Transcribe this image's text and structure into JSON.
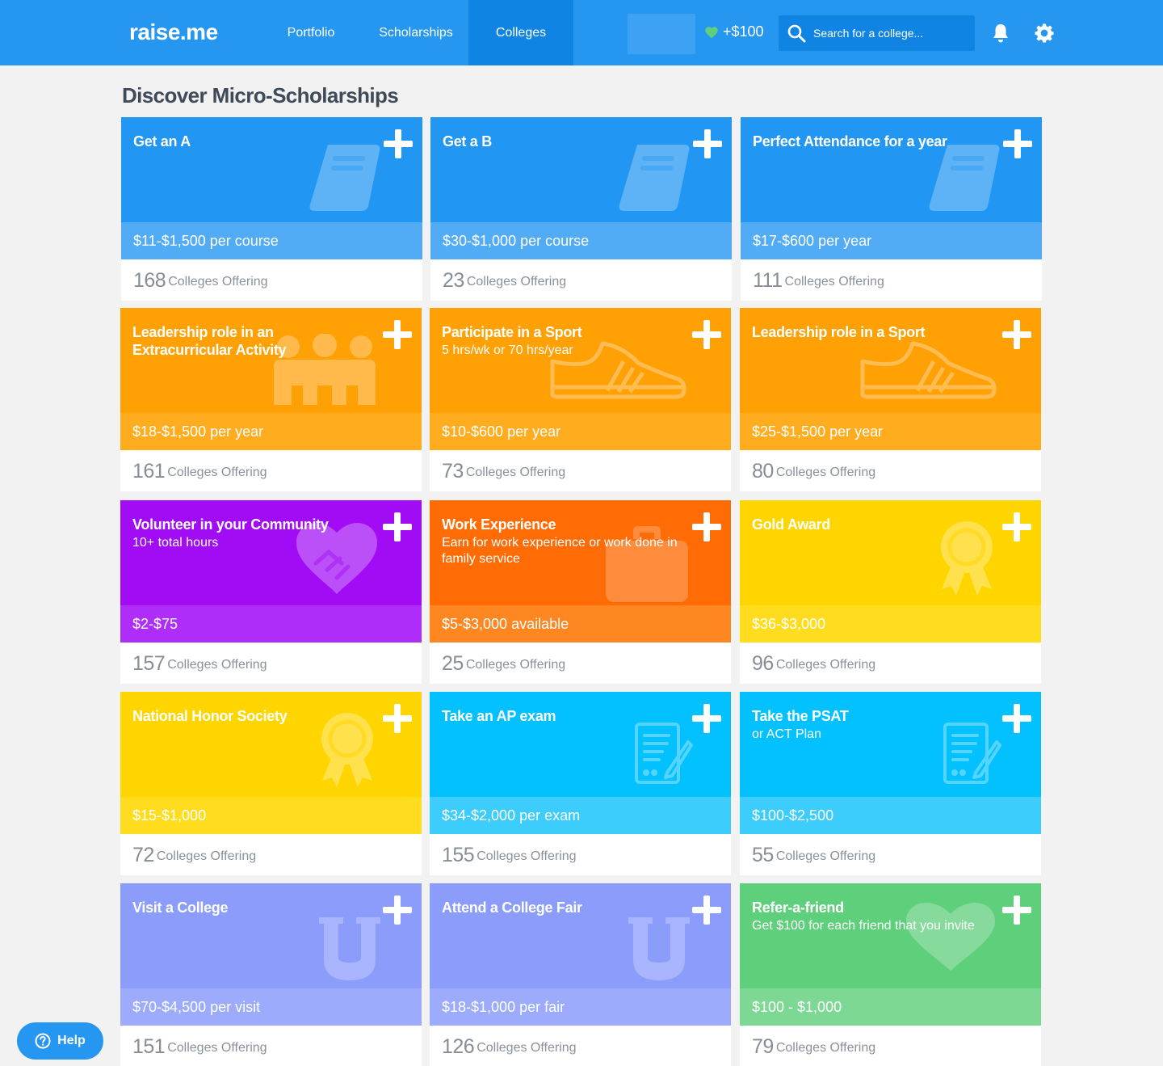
{
  "header": {
    "logo": "raise.me",
    "nav": [
      "Portfolio",
      "Scholarships",
      "Colleges"
    ],
    "active_nav": "Colleges",
    "earned": "+$100",
    "search_placeholder": "Search for a college...",
    "icons": [
      "heart-icon",
      "search-icon",
      "bell-icon",
      "gear-icon"
    ],
    "brand_color": "#2597f1"
  },
  "page": {
    "title": "Discover Micro-Scholarships"
  },
  "cards": [
    {
      "title": "Get an A",
      "subtitle": "",
      "amount": "$11-$1,500 per course",
      "count": "168",
      "count_label": "Colleges Offering",
      "icon": "book-icon",
      "color": "blue"
    },
    {
      "title": "Get a B",
      "subtitle": "",
      "amount": "$30-$1,000 per course",
      "count": "23",
      "count_label": "Colleges Offering",
      "icon": "book-icon",
      "color": "blue"
    },
    {
      "title": "Perfect Attendance for a year",
      "subtitle": "",
      "amount": "$17-$600 per year",
      "count": "111",
      "count_label": "Colleges Offering",
      "icon": "book-icon",
      "color": "blue"
    },
    {
      "title": "Leadership role in an Extracurricular Activity",
      "subtitle": "",
      "amount": "$18-$1,500 per year",
      "count": "161",
      "count_label": "Colleges Offering",
      "icon": "group-icon",
      "color": "orange"
    },
    {
      "title": "Participate in a Sport",
      "subtitle": "5 hrs/wk or 70 hrs/year",
      "amount": "$10-$600 per year",
      "count": "73",
      "count_label": "Colleges Offering",
      "icon": "sneaker-icon",
      "color": "orange"
    },
    {
      "title": "Leadership role in a Sport",
      "subtitle": "",
      "amount": "$25-$1,500 per year",
      "count": "80",
      "count_label": "Colleges Offering",
      "icon": "sneaker-icon",
      "color": "orange"
    },
    {
      "title": "Volunteer in your Community",
      "subtitle": "10+ total hours",
      "amount": "$2-$75",
      "count": "157",
      "count_label": "Colleges Offering",
      "icon": "handshake-heart-icon",
      "color": "purple"
    },
    {
      "title": "Work Experience",
      "subtitle": "Earn for work experience or work done in family service",
      "amount": "$5-$3,000 available",
      "count": "25",
      "count_label": "Colleges Offering",
      "icon": "briefcase-icon",
      "color": "dark-orange"
    },
    {
      "title": "Gold Award",
      "subtitle": "",
      "amount": "$36-$3,000",
      "count": "96",
      "count_label": "Colleges Offering",
      "icon": "award-ribbon-icon",
      "color": "yellow"
    },
    {
      "title": "National Honor Society",
      "subtitle": "",
      "amount": "$15-$1,000",
      "count": "72",
      "count_label": "Colleges Offering",
      "icon": "award-ribbon-icon",
      "color": "yellow"
    },
    {
      "title": "Take an AP exam",
      "subtitle": "",
      "amount": "$34-$2,000 per exam",
      "count": "155",
      "count_label": "Colleges Offering",
      "icon": "exam-paper-icon",
      "color": "cyan"
    },
    {
      "title": "Take the PSAT",
      "subtitle": "or ACT Plan",
      "amount": "$100-$2,500",
      "count": "55",
      "count_label": "Colleges Offering",
      "icon": "exam-paper-icon",
      "color": "cyan"
    },
    {
      "title": "Visit a College",
      "subtitle": "",
      "amount": "$70-$4,500 per visit",
      "count": "151",
      "count_label": "Colleges Offering",
      "icon": "university-u-icon",
      "color": "lavender"
    },
    {
      "title": "Attend a College Fair",
      "subtitle": "",
      "amount": "$18-$1,000 per fair",
      "count": "126",
      "count_label": "Colleges Offering",
      "icon": "university-u-icon",
      "color": "lavender"
    },
    {
      "title": "Refer-a-friend",
      "subtitle": "Get $100 for each friend that you invite",
      "amount": "$100 - $1,000",
      "count": "79",
      "count_label": "Colleges Offering",
      "icon": "heart-icon",
      "color": "green"
    }
  ],
  "help": {
    "label": "Help",
    "icon": "question-circle-icon"
  }
}
